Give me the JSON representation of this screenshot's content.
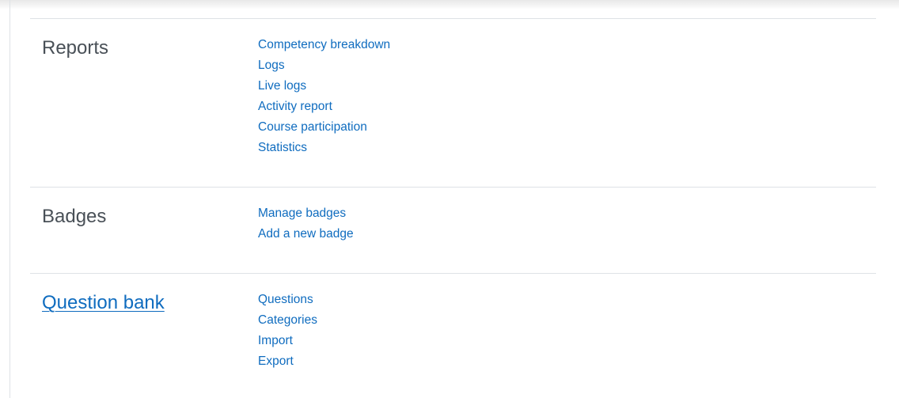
{
  "sections": [
    {
      "title": "Reports",
      "links": [
        "Competency breakdown",
        "Logs",
        "Live logs",
        "Activity report",
        "Course participation",
        "Statistics"
      ]
    },
    {
      "title": "Badges",
      "links": [
        "Manage badges",
        "Add a new badge"
      ]
    },
    {
      "title": "Question bank",
      "links": [
        "Questions",
        "Categories",
        "Import",
        "Export"
      ]
    }
  ],
  "colors": {
    "link": "#0f6cbf",
    "heading": "#495057",
    "divider": "#dee2e6"
  }
}
